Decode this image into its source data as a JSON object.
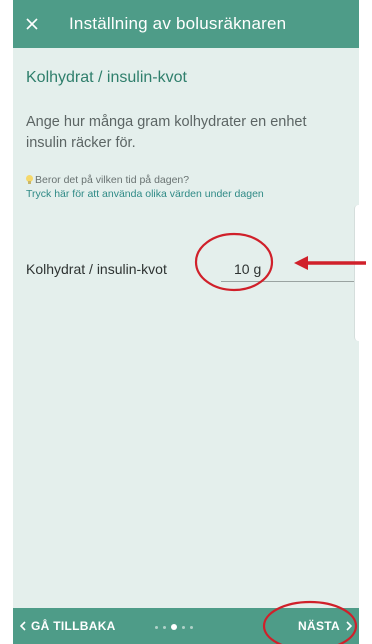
{
  "header": {
    "title": "Inställning av bolusräknaren",
    "close_icon": "close-icon"
  },
  "section": {
    "title": "Kolhydrat / insulin-kvot",
    "description": "Ange hur många gram kolhydrater en enhet insulin räcker för."
  },
  "hint": {
    "icon": "lightbulb-icon",
    "question": "Beror det på vilken tid på dagen?",
    "link": "Tryck här för att använda olika värden under dagen"
  },
  "field": {
    "label": "Kolhydrat / insulin-kvot",
    "value": "10  g"
  },
  "footer": {
    "back_label": "GÅ TILLBAKA",
    "next_label": "NÄSTA",
    "step_count": 5,
    "active_step": 3
  },
  "colors": {
    "primary": "#4e9c88",
    "background": "#e4efec",
    "accent_text": "#2f7f6c",
    "link": "#2f8a86",
    "annotation": "#d0202a"
  }
}
